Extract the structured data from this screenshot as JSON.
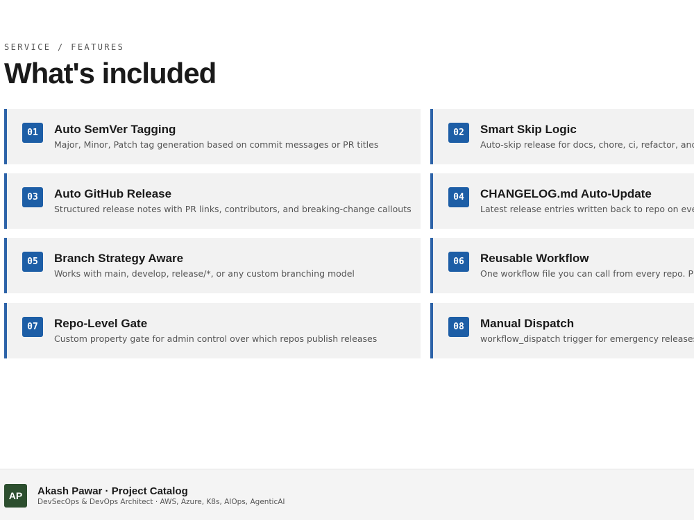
{
  "section": {
    "eyebrow": "SERVICE / FEATURES",
    "title": "What's included"
  },
  "features": [
    {
      "num": "01",
      "title": "Auto SemVer Tagging",
      "desc": "Major, Minor, Patch tag generation based on commit messages or PR titles"
    },
    {
      "num": "02",
      "title": "Smart Skip Logic",
      "desc": "Auto-skip release for docs, chore, ci, refactor, and te"
    },
    {
      "num": "03",
      "title": "Auto GitHub Release",
      "desc": "Structured release notes with PR links, contributors, and breaking-change callouts"
    },
    {
      "num": "04",
      "title": "CHANGELOG.md Auto-Update",
      "desc": "Latest release entries written back to repo on every"
    },
    {
      "num": "05",
      "title": "Branch Strategy Aware",
      "desc": "Works with main, develop, release/*, or any custom branching model"
    },
    {
      "num": "06",
      "title": "Reusable Workflow",
      "desc": "One workflow file you can call from every repo. Plus"
    },
    {
      "num": "07",
      "title": "Repo-Level Gate",
      "desc": "Custom property gate for admin control over which repos publish releases"
    },
    {
      "num": "08",
      "title": "Manual Dispatch",
      "desc": "workflow_dispatch trigger for emergency releases w"
    }
  ],
  "footer": {
    "avatar_initials": "AP",
    "title": "Akash Pawar · Project Catalog",
    "subtitle": "DevSecOps & DevOps Architect · AWS, Azure, K8s, AIOps, AgenticAI"
  },
  "colors": {
    "accent": "#1d5ea6",
    "card_border": "#2d63a8",
    "card_bg": "#f2f2f2",
    "avatar_bg": "#2c4e2e"
  }
}
